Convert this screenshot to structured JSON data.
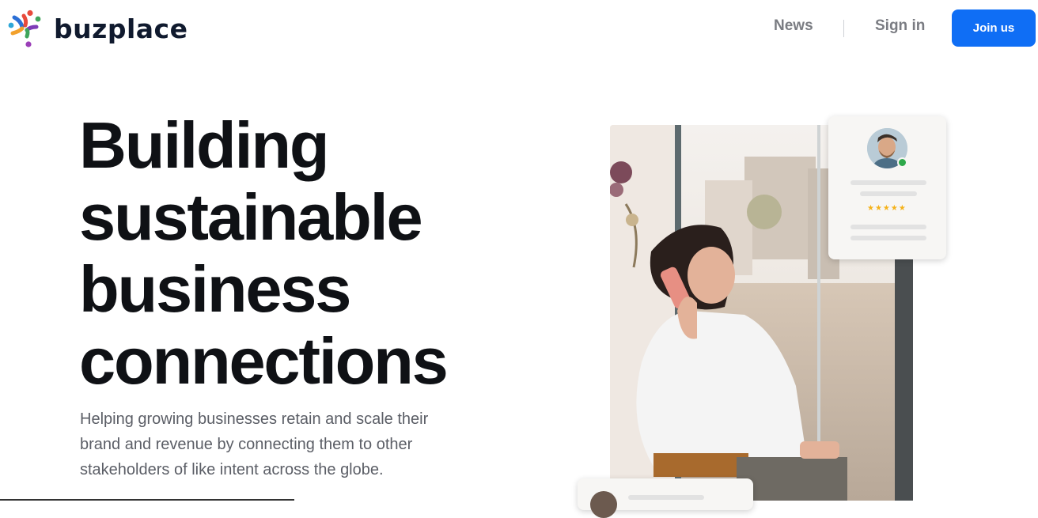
{
  "brand": {
    "name": "buzplace",
    "logo_icon": "buzplace-logo-icon",
    "colors": {
      "brand_dark": "#101a2e",
      "accent": "#0f6ef5"
    }
  },
  "nav": {
    "news": "News",
    "sign_in": "Sign in",
    "join": "Join us"
  },
  "hero": {
    "title_lines": [
      "Building",
      "sustainable",
      "business",
      "connections"
    ],
    "subtitle": "Helping growing businesses retain and scale their brand and revenue by connecting them to other stakeholders of like intent across the globe."
  },
  "review_card": {
    "stars": "★★★★★",
    "rating_icon": "star-rating-icon",
    "status_color": "#2ea84a"
  }
}
